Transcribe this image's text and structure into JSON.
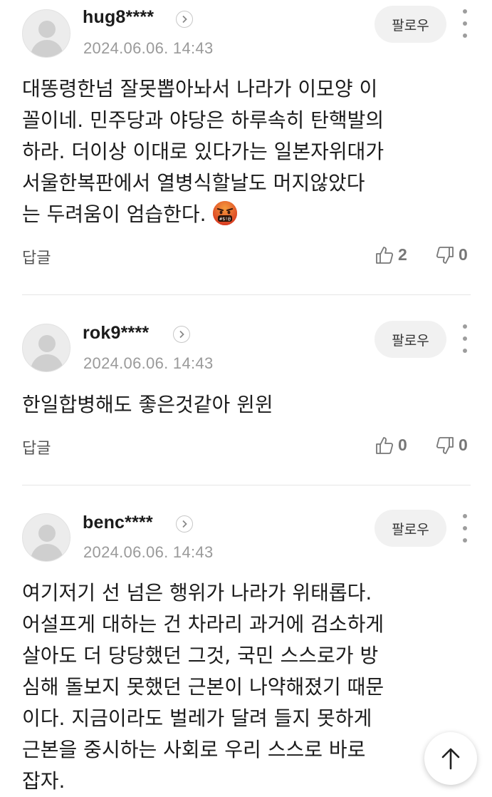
{
  "comments": [
    {
      "username": "hug8****",
      "date": "2024.06.06. 14:43",
      "follow_label": "팔로우",
      "lines": [
        "대똥령한넘 잘못뽑아놔서 나라가 이모양 이",
        "꼴이네. 민주당과 야당은 하루속히 탄핵발의",
        "하라. 더이상 이대로 있다가는 일본자위대가",
        "서울한복판에서 열병식할날도 머지않았다",
        "는 두려움이 엄습한다."
      ],
      "emoji": "face-with-symbols-on-mouth-emoji",
      "reply_label": "답글",
      "likes": "2",
      "dislikes": "0"
    },
    {
      "username": "rok9****",
      "date": "2024.06.06. 14:43",
      "follow_label": "팔로우",
      "lines": [
        "한일합병해도 좋은것같아 윈윈"
      ],
      "reply_label": "답글",
      "likes": "0",
      "dislikes": "0"
    },
    {
      "username": "benc****",
      "date": "2024.06.06. 14:43",
      "follow_label": "팔로우",
      "lines": [
        "여기저기 선 넘은 행위가 나라가 위태롭다.",
        "어설프게 대하는 건 차라리 과거에 검소하게",
        "살아도 더 당당했던 그것, 국민 스스로가 방",
        "심해 돌보지 못했던 근본이 나약해졌기 때문",
        "이다. 지금이라도 벌레가 달려 들지 못하게",
        "근본을 중시하는 사회로 우리 스스로 바로",
        "잡자."
      ]
    }
  ],
  "icons": {
    "thumb_up": "thumb-up-icon",
    "thumb_down": "thumb-down-icon",
    "more": "more-vertical-icon",
    "chevron": "chevron-right-icon",
    "scroll_top": "arrow-up-icon"
  },
  "colors": {
    "text": "#1b1b1b",
    "meta": "#9a9a9a",
    "follow_bg": "#f1f1f1",
    "divider": "#e6e6e6"
  }
}
